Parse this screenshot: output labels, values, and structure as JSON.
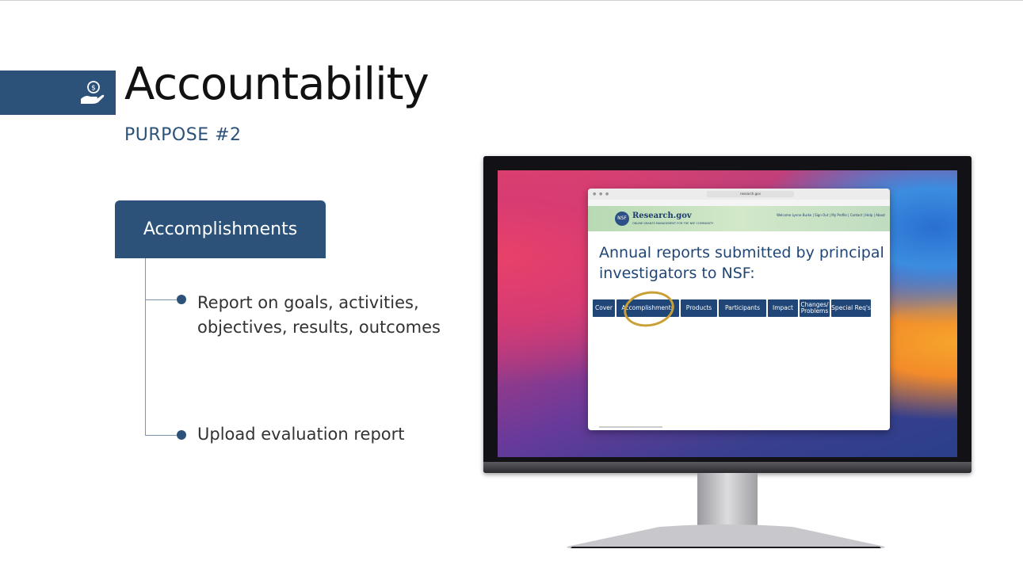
{
  "slide": {
    "title": "Accountability",
    "subtitle": "PURPOSE #2",
    "accomplishments_label": "Accomplishments",
    "bullets": [
      "Report on goals, activities, objectives, results, outcomes",
      "Upload evaluation report"
    ]
  },
  "browser": {
    "url": "research.gov",
    "logo_text": "Research.gov",
    "logo_tagline": "ONLINE GRANTS MANAGEMENT FOR THE NSF COMMUNITY",
    "header_links": "Welcome Lynne Burke | Sign Out | My Profile | Contact | Help | About",
    "headline": "Annual reports submitted by principal investigators to NSF:",
    "tabs": [
      "Cover",
      "Accomplishments",
      "Products",
      "Participants",
      "Impact",
      "Changes/ Problems",
      "Special Req's"
    ]
  },
  "colors": {
    "brand_blue": "#2c5279",
    "highlight_circle": "#c9a036"
  },
  "icons": {
    "title_icon": "hand-holding-dollar-icon"
  }
}
